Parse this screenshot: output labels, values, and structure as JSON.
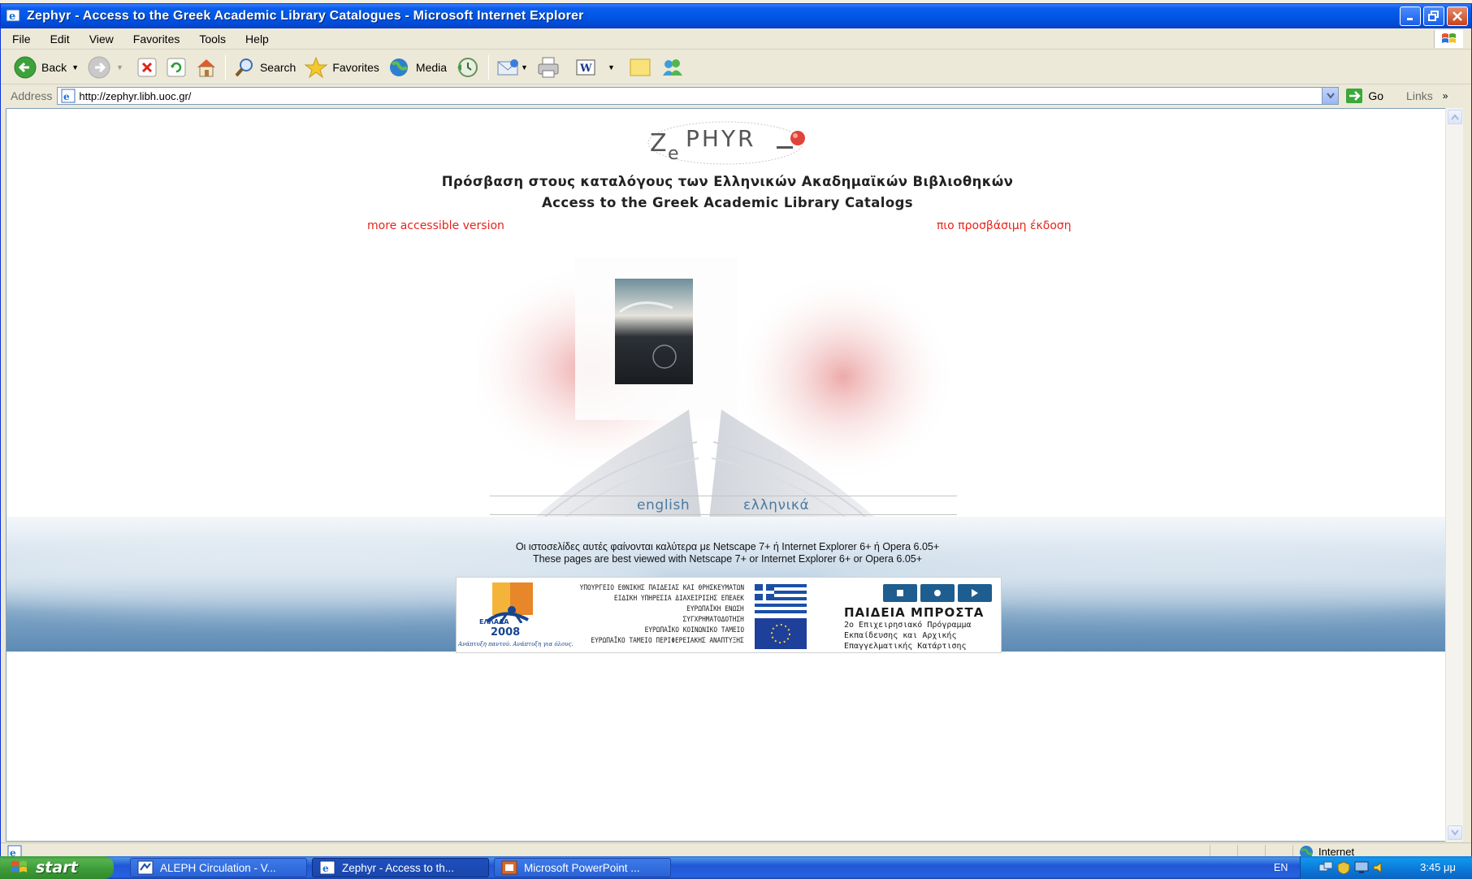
{
  "window": {
    "title": "Zephyr - Access to the Greek Academic Library Catalogues - Microsoft Internet Explorer"
  },
  "menu": [
    "File",
    "Edit",
    "View",
    "Favorites",
    "Tools",
    "Help"
  ],
  "toolbar": {
    "back_label": "Back",
    "search_label": "Search",
    "favorites_label": "Favorites",
    "media_label": "Media",
    "icons": [
      "back-icon",
      "forward-icon",
      "stop-icon",
      "refresh-icon",
      "home-icon",
      "search-icon",
      "favorites-icon",
      "media-icon",
      "history-icon",
      "mail-icon",
      "print-icon",
      "edit-icon",
      "discuss-icon",
      "messenger-icon"
    ]
  },
  "address": {
    "label": "Address",
    "url": "http://zephyr.libh.uoc.gr/",
    "go_label": "Go",
    "links_label": "Links"
  },
  "page": {
    "logo_text": "ZePHYR",
    "heading_gr": "Πρόσβαση στους καταλόγους των Ελληνικών Ακαδημαϊκών Βιβλιοθηκών",
    "heading_en": "Access to the Greek Academic Library Catalogs",
    "accessible_en": "more accessible version",
    "accessible_gr": "πιο προσβάσιμη έκδοση",
    "lang_english": "english",
    "lang_greek": "ελληνικά",
    "note_gr": "Οι ιστοσελίδες αυτές φαίνονται καλύτερα με Netscape 7+ ή Internet Explorer 6+ ή Opera 6.05+",
    "note_en": "These pages are best viewed with Netscape 7+ or Internet Explorer 6+ or Opera 6.05+",
    "sponsor": {
      "hellas_label": "ΕΛΛΑΔΑ",
      "hellas_year": "2008",
      "hellas_motto": "Ανάπτυξη παντού. Ανάπτυξη για όλους.",
      "ministry_lines": [
        "ΥΠΟΥΡΓΕΙΟ ΕΘΝΙΚΗΣ ΠΑΙΔΕΙΑΣ ΚΑΙ ΘΡΗΣΚΕΥΜΑΤΩΝ",
        "ΕΙΔΙΚΗ ΥΠΗΡΕΣΙΑ ΔΙΑΧΕΙΡΙΣΗΣ ΕΠΕΑΕΚ",
        "ΕΥΡΩΠΑΪΚΗ ΕΝΩΣΗ",
        "ΣΥΓΧΡΗΜΑΤΟΔΟΤΗΣΗ",
        "ΕΥΡΩΠΑΪΚΟ ΚΟΙΝΩΝΙΚΟ ΤΑΜΕΙΟ",
        "ΕΥΡΩΠΑΪΚΟ ΤΑΜΕΙΟ ΠΕΡΙΦΕΡΕΙΑΚΗΣ ΑΝΑΠΤΥΞΗΣ"
      ],
      "paideia_title": "ΠΑΙΔΕΙΑ ΜΠΡΟΣΤΑ",
      "paideia_sub": [
        "2ο Επιχειρησιακό Πρόγραμμα",
        "Εκπαίδευσης και Αρχικής",
        "Επαγγελματικής Κατάρτισης"
      ]
    }
  },
  "status": {
    "zone": "Internet"
  },
  "taskbar": {
    "start_label": "start",
    "tasks": [
      {
        "label": "ALEPH Circulation - V...",
        "icon": "aleph-icon",
        "active": false
      },
      {
        "label": "Zephyr - Access to th...",
        "icon": "ie-icon",
        "active": true
      },
      {
        "label": "Microsoft PowerPoint ...",
        "icon": "powerpoint-icon",
        "active": false
      }
    ],
    "language": "EN",
    "clock": "3:45 μμ"
  },
  "colors": {
    "titlebar_blue": "#0058e6",
    "link_red": "#e8231b",
    "lang_link_blue": "#4a7aa0",
    "start_green": "#3f9c3a"
  }
}
